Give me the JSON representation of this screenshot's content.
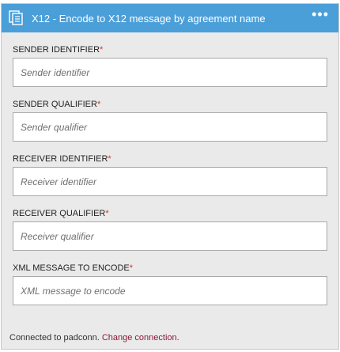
{
  "header": {
    "title": "X12 - Encode to X12 message by agreement name",
    "menu_label": "•••"
  },
  "fields": [
    {
      "label": "SENDER IDENTIFIER",
      "required_mark": "*",
      "placeholder": "Sender identifier",
      "value": ""
    },
    {
      "label": "SENDER QUALIFIER",
      "required_mark": "*",
      "placeholder": "Sender qualifier",
      "value": ""
    },
    {
      "label": "RECEIVER IDENTIFIER",
      "required_mark": "*",
      "placeholder": "Receiver identifier",
      "value": ""
    },
    {
      "label": "RECEIVER QUALIFIER",
      "required_mark": "*",
      "placeholder": "Receiver qualifier",
      "value": ""
    },
    {
      "label": "XML MESSAGE TO ENCODE",
      "required_mark": "*",
      "placeholder": "XML message to encode",
      "value": ""
    }
  ],
  "footer": {
    "connected_text": "Connected to padconn.",
    "change_link": "Change connection."
  },
  "colors": {
    "header_bg": "#4b9fd8",
    "card_bg": "#eaeaea",
    "required": "#d0342c",
    "link": "#8b1a3a"
  }
}
